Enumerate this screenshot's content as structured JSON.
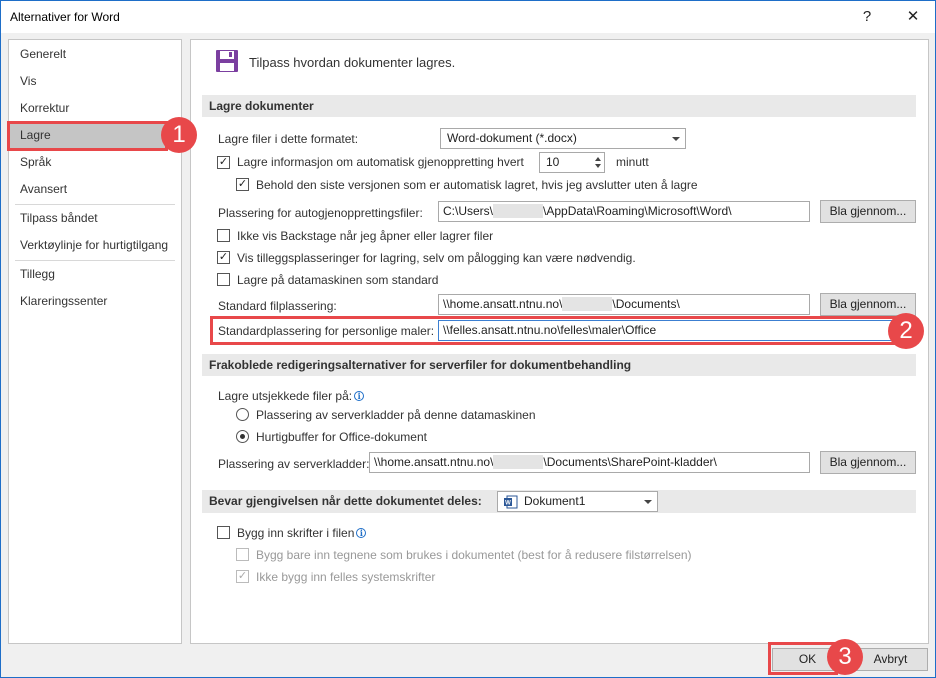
{
  "window": {
    "title": "Alternativer for Word",
    "help_glyph": "?",
    "close_glyph": "✕"
  },
  "sidebar": {
    "items": [
      {
        "label": "Generelt"
      },
      {
        "label": "Vis"
      },
      {
        "label": "Korrektur"
      },
      {
        "label": "Lagre"
      },
      {
        "label": "Språk"
      },
      {
        "label": "Avansert"
      },
      {
        "label": "Tilpass båndet"
      },
      {
        "label": "Verktøylinje for hurtigtilgang"
      },
      {
        "label": "Tillegg"
      },
      {
        "label": "Klareringssenter"
      }
    ],
    "selected": "Lagre"
  },
  "header": {
    "text": "Tilpass hvordan dokumenter lagres."
  },
  "save_docs": {
    "heading": "Lagre dokumenter",
    "format_label": "Lagre filer i dette formatet:",
    "format_value": "Word-dokument (*.docx)",
    "autorecover_label": "Lagre informasjon om automatisk gjenoppretting hvert",
    "autorecover_minutes": "10",
    "autorecover_unit": "minutt",
    "keep_last_label": "Behold den siste versjonen som er automatisk lagret, hvis jeg avslutter uten å lagre",
    "autorecover_location_label": "Plassering for autogjenopprettingsfiler:",
    "autorecover_location_prefix": "C:\\Users\\",
    "autorecover_location_suffix": "\\AppData\\Roaming\\Microsoft\\Word\\",
    "browse_label": "Bla gjennom...",
    "no_backstage_label": "Ikke vis Backstage når jeg åpner eller lagrer filer",
    "show_extra_label": "Vis tilleggsplasseringer for lagring, selv om pålogging kan være nødvendig.",
    "save_computer_label": "Lagre på datamaskinen som standard",
    "default_location_label": "Standard filplassering:",
    "default_location_prefix": "\\\\home.ansatt.ntnu.no\\",
    "default_location_suffix": "\\Documents\\",
    "browse_label_2": "Bla gjennom...",
    "templates_label": "Standardplassering for personlige maler:",
    "templates_value": "\\\\felles.ansatt.ntnu.no\\felles\\maler\\Office"
  },
  "offline": {
    "heading": "Frakoblede redigeringsalternativer for serverfiler for dokumentbehandling",
    "checked_out_label": "Lagre utsjekkede filer på:",
    "radio_server_label": "Plassering av serverkladder på denne datamaskinen",
    "radio_cache_label": "Hurtigbuffer for Office-dokument",
    "drafts_location_label": "Plassering av serverkladder:",
    "drafts_location_prefix": "\\\\home.ansatt.ntnu.no\\",
    "drafts_location_suffix": "\\Documents\\SharePoint-kladder\\",
    "browse_label_3": "Bla gjennom..."
  },
  "fidelity": {
    "heading": "Bevar gjengivelsen når dette dokumentet deles:",
    "document_value": "Dokument1",
    "embed_fonts_label": "Bygg inn skrifter i filen",
    "embed_used_label": "Bygg bare inn tegnene som brukes i dokumentet (best for å redusere filstørrelsen)",
    "no_common_label": "Ikke bygg inn felles systemskrifter"
  },
  "footer": {
    "ok_label": "OK",
    "cancel_label": "Avbryt"
  },
  "annotations": {
    "badge_1": "1",
    "badge_2": "2",
    "badge_3": "3",
    "color": "#e8484a"
  },
  "checkbox_glyph": "✓"
}
